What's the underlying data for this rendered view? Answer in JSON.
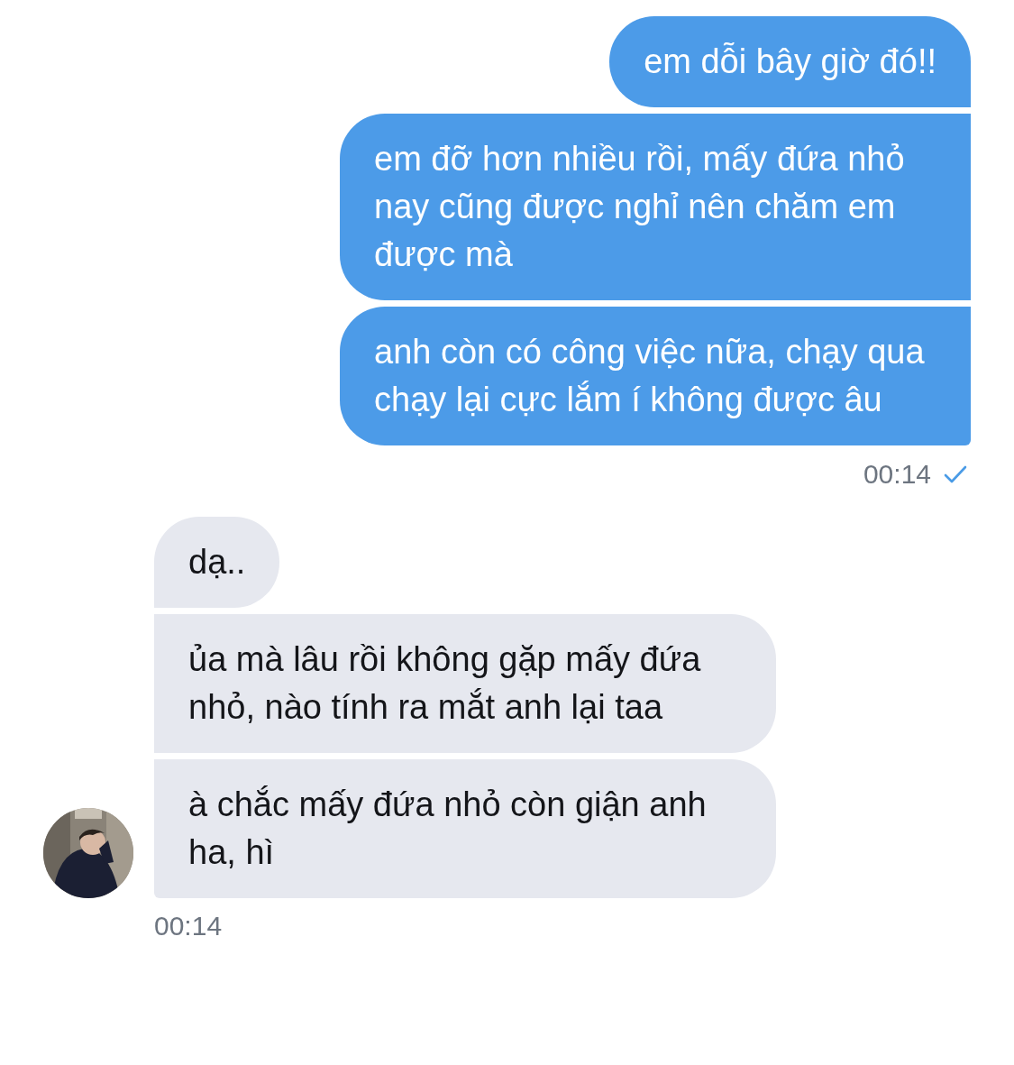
{
  "sent": {
    "bubbles": [
      "em dỗi bây giờ đó!!",
      "em đỡ hơn nhiều rồi, mấy đứa nhỏ nay cũng được nghỉ nên chăm em được mà",
      "anh còn có công việc nữa, chạy qua chạy lại cực lắm í không được âu"
    ],
    "time": "00:14",
    "read": true
  },
  "received": {
    "bubbles": [
      "dạ..",
      "ủa mà lâu rồi không gặp mấy đứa nhỏ, nào tính ra mắt anh lại taa",
      "à chắc mấy đứa nhỏ còn giận anh ha, hì"
    ],
    "time": "00:14"
  }
}
